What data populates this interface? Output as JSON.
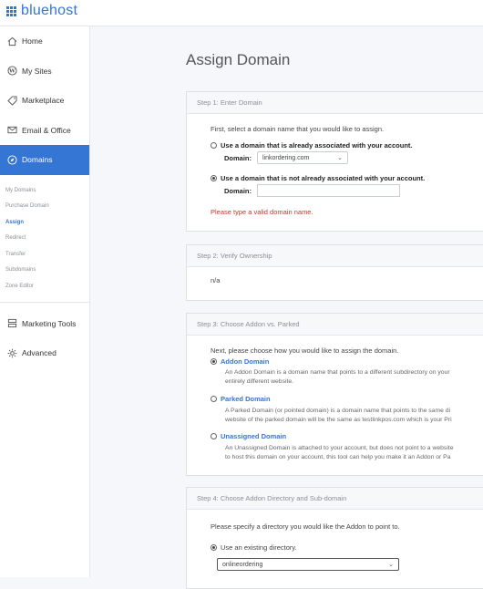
{
  "brand": {
    "name": "bluehost",
    "accent": "#3575d3"
  },
  "sidebar": {
    "items_top": [
      {
        "label": "Home",
        "icon": "home-icon"
      },
      {
        "label": "My Sites",
        "icon": "wordpress-icon"
      },
      {
        "label": "Marketplace",
        "icon": "tag-icon"
      },
      {
        "label": "Email & Office",
        "icon": "envelope-icon"
      },
      {
        "label": "Domains",
        "icon": "compass-icon",
        "active": true
      }
    ],
    "subnav": [
      "My Domains",
      "Purchase Domain",
      "Assign",
      "Redirect",
      "Transfer",
      "Subdomains",
      "Zone Editor"
    ],
    "subnav_current": "Assign",
    "items_bottom": [
      {
        "label": "Marketing Tools",
        "icon": "server-icon"
      },
      {
        "label": "Advanced",
        "icon": "gear-icon"
      }
    ]
  },
  "page": {
    "title": "Assign Domain"
  },
  "step1": {
    "heading": "Step 1: Enter Domain",
    "intro": "First, select a domain name that you would like to assign.",
    "option1": "Use a domain that is already associated with your account.",
    "domain_label": "Domain:",
    "option1_select": "linkordering.com",
    "option2": "Use a domain that is not already associated with your account.",
    "option2_value": "",
    "error": "Please type a valid domain name."
  },
  "step2": {
    "heading": "Step 2: Verify Ownership",
    "value": "n/a"
  },
  "step3": {
    "heading": "Step 3: Choose Addon vs. Parked",
    "intro": "Next, please choose how you would like to assign the domain.",
    "addon_title": "Addon Domain",
    "addon_desc1": "An Addon Domain is a domain name that points to a different subdirectory on your",
    "addon_desc2": "entirely different website.",
    "parked_title": "Parked Domain",
    "parked_desc1": "A Parked Domain (or pointed domain) is a domain name that points to the same di",
    "parked_desc2": "website of the parked domain will be the same as testlinkpos.com which is your Pri",
    "unassigned_title": "Unassigned Domain",
    "unassigned_desc1": "An Unassigned Domain is attached to your account, but does not point to a website",
    "unassigned_desc2": "to host this domain on your account, this tool can help you make it an Addon or Pa"
  },
  "step4": {
    "heading": "Step 4: Choose Addon Directory and Sub-domain",
    "intro": "Please specify a directory you would like the Addon to point to.",
    "option": "Use an existing directory.",
    "dir_select": "onlineordering"
  }
}
